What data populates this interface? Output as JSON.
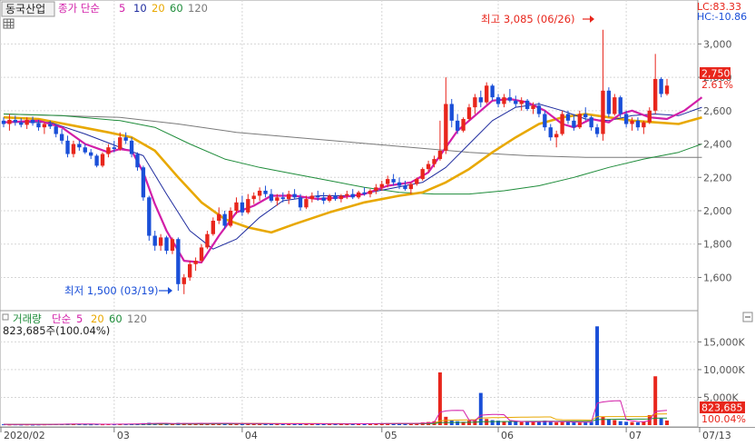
{
  "header": {
    "stock_name": "동국산업",
    "price_type": "종가 단순",
    "ma_periods": [
      "5",
      "10",
      "20",
      "60",
      "120"
    ],
    "lc": "LC:83.33",
    "hc": "HC:-10.86"
  },
  "volume_header": {
    "title": "거래량",
    "type": "단순",
    "ma_periods": [
      "5",
      "20",
      "60",
      "120"
    ],
    "value_text": "823,685주(100.04%)"
  },
  "annotations": {
    "high": "최고 3,085 (06/26)",
    "low": "최저 1,500 (03/19)"
  },
  "price_axis_labels": [
    "3,000",
    "2,800",
    "2,600",
    "2,400",
    "2,200",
    "2,000",
    "1,800",
    "1,600"
  ],
  "volume_axis_labels": [
    "15,000K",
    "10,000K",
    "5,000K"
  ],
  "x_axis_labels": [
    "2020/02",
    "03",
    "04",
    "05",
    "06",
    "07",
    "07/13"
  ],
  "badges": {
    "price": "2,750",
    "price_pct": "2.61%",
    "volume": "823,685",
    "volume_pct": "100.04%"
  },
  "colors": {
    "up": "#e8261c",
    "down": "#1a4fd8",
    "ma5": "#d21ea8",
    "ma10": "#1e2b9e",
    "ma20": "#e8a800",
    "ma60": "#1e8c3a",
    "ma120": "#7a7a7a"
  },
  "chart_data": {
    "type": "candlestick",
    "title": "동국산업",
    "y_axis": {
      "min": 1450,
      "max": 3100,
      "ticks": [
        1600,
        1800,
        2000,
        2200,
        2400,
        2600,
        2800,
        3000
      ]
    },
    "x_ticks": [
      {
        "label": "2020/02",
        "index": 0
      },
      {
        "label": "03",
        "index": 19
      },
      {
        "label": "04",
        "index": 41
      },
      {
        "label": "05",
        "index": 65
      },
      {
        "label": "06",
        "index": 85
      },
      {
        "label": "07",
        "index": 107
      },
      {
        "label": "07/13",
        "index": 120
      }
    ],
    "high": {
      "value": 3085,
      "date": "06/26"
    },
    "low": {
      "value": 1500,
      "date": "03/19"
    },
    "last_close": 2750,
    "last_change_pct": 2.61,
    "candles": [
      [
        2540,
        2560,
        2500,
        2520
      ],
      [
        2520,
        2580,
        2480,
        2545
      ],
      [
        2545,
        2570,
        2510,
        2530
      ],
      [
        2530,
        2555,
        2500,
        2515
      ],
      [
        2515,
        2560,
        2490,
        2545
      ],
      [
        2545,
        2565,
        2510,
        2525
      ],
      [
        2525,
        2545,
        2480,
        2500
      ],
      [
        2500,
        2530,
        2460,
        2520
      ],
      [
        2520,
        2540,
        2490,
        2505
      ],
      [
        2505,
        2520,
        2440,
        2460
      ],
      [
        2460,
        2490,
        2400,
        2420
      ],
      [
        2420,
        2450,
        2320,
        2340
      ],
      [
        2340,
        2420,
        2320,
        2400
      ],
      [
        2400,
        2420,
        2360,
        2380
      ],
      [
        2380,
        2400,
        2340,
        2350
      ],
      [
        2350,
        2370,
        2310,
        2330
      ],
      [
        2330,
        2340,
        2260,
        2270
      ],
      [
        2270,
        2350,
        2260,
        2340
      ],
      [
        2340,
        2400,
        2320,
        2380
      ],
      [
        2380,
        2420,
        2350,
        2370
      ],
      [
        2370,
        2470,
        2360,
        2440
      ],
      [
        2440,
        2470,
        2400,
        2420
      ],
      [
        2420,
        2440,
        2320,
        2340
      ],
      [
        2340,
        2350,
        2240,
        2260
      ],
      [
        2260,
        2270,
        2060,
        2080
      ],
      [
        2080,
        2090,
        1820,
        1850
      ],
      [
        1850,
        1880,
        1760,
        1790
      ],
      [
        1790,
        1860,
        1760,
        1840
      ],
      [
        1840,
        1850,
        1740,
        1760
      ],
      [
        1760,
        1840,
        1740,
        1830
      ],
      [
        1830,
        1840,
        1520,
        1560
      ],
      [
        1560,
        1620,
        1500,
        1600
      ],
      [
        1600,
        1700,
        1580,
        1680
      ],
      [
        1680,
        1720,
        1640,
        1700
      ],
      [
        1700,
        1800,
        1690,
        1780
      ],
      [
        1780,
        1880,
        1770,
        1860
      ],
      [
        1860,
        1960,
        1850,
        1940
      ],
      [
        1940,
        2020,
        1920,
        1980
      ],
      [
        1980,
        2000,
        1890,
        1910
      ],
      [
        1910,
        2020,
        1900,
        2000
      ],
      [
        2000,
        2080,
        1980,
        2050
      ],
      [
        2050,
        2090,
        1970,
        1990
      ],
      [
        1990,
        2100,
        1980,
        2070
      ],
      [
        2070,
        2110,
        2040,
        2090
      ],
      [
        2090,
        2140,
        2060,
        2120
      ],
      [
        2120,
        2150,
        2080,
        2100
      ],
      [
        2100,
        2130,
        2050,
        2060
      ],
      [
        2060,
        2100,
        2030,
        2080
      ],
      [
        2080,
        2110,
        2050,
        2070
      ],
      [
        2070,
        2120,
        2040,
        2100
      ],
      [
        2100,
        2130,
        2070,
        2080
      ],
      [
        2080,
        2100,
        2000,
        2020
      ],
      [
        2020,
        2090,
        2010,
        2070
      ],
      [
        2070,
        2110,
        2050,
        2090
      ],
      [
        2090,
        2120,
        2060,
        2080
      ],
      [
        2080,
        2110,
        2040,
        2060
      ],
      [
        2060,
        2100,
        2050,
        2090
      ],
      [
        2090,
        2110,
        2060,
        2070
      ],
      [
        2070,
        2100,
        2050,
        2090
      ],
      [
        2090,
        2120,
        2070,
        2100
      ],
      [
        2100,
        2130,
        2070,
        2080
      ],
      [
        2080,
        2120,
        2070,
        2110
      ],
      [
        2110,
        2140,
        2090,
        2100
      ],
      [
        2100,
        2130,
        2080,
        2120
      ],
      [
        2120,
        2160,
        2100,
        2140
      ],
      [
        2140,
        2180,
        2120,
        2160
      ],
      [
        2160,
        2210,
        2140,
        2190
      ],
      [
        2190,
        2220,
        2150,
        2170
      ],
      [
        2170,
        2200,
        2130,
        2150
      ],
      [
        2150,
        2180,
        2120,
        2130
      ],
      [
        2130,
        2170,
        2100,
        2160
      ],
      [
        2160,
        2200,
        2150,
        2190
      ],
      [
        2190,
        2260,
        2180,
        2250
      ],
      [
        2250,
        2300,
        2230,
        2280
      ],
      [
        2280,
        2330,
        2260,
        2310
      ],
      [
        2310,
        2540,
        2300,
        2360
      ],
      [
        2360,
        2800,
        2340,
        2640
      ],
      [
        2640,
        2670,
        2500,
        2540
      ],
      [
        2540,
        2580,
        2460,
        2480
      ],
      [
        2480,
        2560,
        2470,
        2550
      ],
      [
        2550,
        2640,
        2540,
        2620
      ],
      [
        2620,
        2700,
        2580,
        2680
      ],
      [
        2680,
        2720,
        2620,
        2650
      ],
      [
        2650,
        2770,
        2640,
        2750
      ],
      [
        2750,
        2760,
        2660,
        2680
      ],
      [
        2680,
        2700,
        2620,
        2640
      ],
      [
        2640,
        2700,
        2620,
        2680
      ],
      [
        2680,
        2730,
        2650,
        2660
      ],
      [
        2660,
        2690,
        2620,
        2640
      ],
      [
        2640,
        2680,
        2600,
        2660
      ],
      [
        2660,
        2670,
        2600,
        2610
      ],
      [
        2610,
        2650,
        2580,
        2630
      ],
      [
        2630,
        2650,
        2560,
        2580
      ],
      [
        2580,
        2600,
        2480,
        2500
      ],
      [
        2500,
        2520,
        2420,
        2440
      ],
      [
        2440,
        2480,
        2380,
        2460
      ],
      [
        2460,
        2600,
        2450,
        2580
      ],
      [
        2580,
        2600,
        2520,
        2540
      ],
      [
        2540,
        2580,
        2480,
        2500
      ],
      [
        2500,
        2600,
        2490,
        2580
      ],
      [
        2580,
        2620,
        2540,
        2560
      ],
      [
        2560,
        2570,
        2480,
        2500
      ],
      [
        2500,
        2520,
        2440,
        2460
      ],
      [
        2460,
        3085,
        2420,
        2720
      ],
      [
        2720,
        2740,
        2560,
        2580
      ],
      [
        2580,
        2700,
        2570,
        2680
      ],
      [
        2680,
        2690,
        2560,
        2580
      ],
      [
        2580,
        2600,
        2500,
        2520
      ],
      [
        2520,
        2560,
        2480,
        2540
      ],
      [
        2540,
        2560,
        2480,
        2500
      ],
      [
        2500,
        2540,
        2460,
        2530
      ],
      [
        2530,
        2620,
        2520,
        2600
      ],
      [
        2600,
        2940,
        2580,
        2790
      ],
      [
        2790,
        2800,
        2680,
        2700
      ],
      [
        2700,
        2790,
        2690,
        2750
      ]
    ],
    "ma_series": [
      {
        "name": "5",
        "points": [
          [
            0,
            2530
          ],
          [
            6,
            2540
          ],
          [
            10,
            2500
          ],
          [
            14,
            2400
          ],
          [
            18,
            2350
          ],
          [
            20,
            2370
          ],
          [
            22,
            2360
          ],
          [
            24,
            2230
          ],
          [
            26,
            2040
          ],
          [
            28,
            1880
          ],
          [
            31,
            1700
          ],
          [
            34,
            1690
          ],
          [
            37,
            1850
          ],
          [
            40,
            1990
          ],
          [
            43,
            2030
          ],
          [
            46,
            2090
          ],
          [
            50,
            2090
          ],
          [
            54,
            2070
          ],
          [
            58,
            2080
          ],
          [
            62,
            2100
          ],
          [
            66,
            2150
          ],
          [
            70,
            2170
          ],
          [
            73,
            2230
          ],
          [
            76,
            2380
          ],
          [
            78,
            2480
          ],
          [
            80,
            2540
          ],
          [
            82,
            2600
          ],
          [
            84,
            2660
          ],
          [
            87,
            2670
          ],
          [
            90,
            2650
          ],
          [
            93,
            2600
          ],
          [
            96,
            2520
          ],
          [
            98,
            2500
          ],
          [
            101,
            2550
          ],
          [
            104,
            2530
          ],
          [
            106,
            2580
          ],
          [
            108,
            2600
          ],
          [
            111,
            2560
          ],
          [
            114,
            2550
          ],
          [
            117,
            2600
          ],
          [
            120,
            2680
          ]
        ]
      },
      {
        "name": "10",
        "points": [
          [
            0,
            2530
          ],
          [
            8,
            2530
          ],
          [
            14,
            2460
          ],
          [
            20,
            2380
          ],
          [
            24,
            2330
          ],
          [
            28,
            2100
          ],
          [
            32,
            1880
          ],
          [
            36,
            1770
          ],
          [
            40,
            1830
          ],
          [
            44,
            1960
          ],
          [
            48,
            2060
          ],
          [
            54,
            2090
          ],
          [
            60,
            2090
          ],
          [
            66,
            2130
          ],
          [
            72,
            2170
          ],
          [
            76,
            2260
          ],
          [
            80,
            2400
          ],
          [
            84,
            2540
          ],
          [
            88,
            2620
          ],
          [
            92,
            2640
          ],
          [
            96,
            2600
          ],
          [
            100,
            2550
          ],
          [
            104,
            2540
          ],
          [
            108,
            2570
          ],
          [
            112,
            2580
          ],
          [
            116,
            2570
          ],
          [
            120,
            2620
          ]
        ]
      },
      {
        "name": "20",
        "points": [
          [
            0,
            2560
          ],
          [
            6,
            2550
          ],
          [
            12,
            2510
          ],
          [
            18,
            2470
          ],
          [
            22,
            2440
          ],
          [
            26,
            2360
          ],
          [
            30,
            2200
          ],
          [
            34,
            2050
          ],
          [
            38,
            1950
          ],
          [
            42,
            1900
          ],
          [
            46,
            1870
          ],
          [
            50,
            1920
          ],
          [
            56,
            1990
          ],
          [
            62,
            2050
          ],
          [
            68,
            2090
          ],
          [
            72,
            2110
          ],
          [
            76,
            2170
          ],
          [
            80,
            2250
          ],
          [
            84,
            2350
          ],
          [
            88,
            2440
          ],
          [
            92,
            2520
          ],
          [
            96,
            2560
          ],
          [
            100,
            2580
          ],
          [
            104,
            2560
          ],
          [
            108,
            2540
          ],
          [
            112,
            2530
          ],
          [
            116,
            2520
          ],
          [
            120,
            2560
          ]
        ]
      },
      {
        "name": "60",
        "points": [
          [
            0,
            2580
          ],
          [
            10,
            2570
          ],
          [
            20,
            2540
          ],
          [
            26,
            2500
          ],
          [
            32,
            2400
          ],
          [
            38,
            2310
          ],
          [
            44,
            2260
          ],
          [
            50,
            2220
          ],
          [
            56,
            2180
          ],
          [
            62,
            2140
          ],
          [
            68,
            2110
          ],
          [
            74,
            2100
          ],
          [
            80,
            2100
          ],
          [
            86,
            2120
          ],
          [
            92,
            2150
          ],
          [
            98,
            2200
          ],
          [
            104,
            2260
          ],
          [
            110,
            2310
          ],
          [
            116,
            2350
          ],
          [
            120,
            2400
          ]
        ]
      },
      {
        "name": "120",
        "points": [
          [
            0,
            2580
          ],
          [
            20,
            2560
          ],
          [
            30,
            2520
          ],
          [
            40,
            2470
          ],
          [
            50,
            2440
          ],
          [
            60,
            2410
          ],
          [
            70,
            2380
          ],
          [
            80,
            2350
          ],
          [
            90,
            2330
          ],
          [
            100,
            2320
          ],
          [
            110,
            2320
          ],
          [
            120,
            2320
          ]
        ]
      }
    ],
    "volume": {
      "y_axis": {
        "min": 0,
        "max": 18500,
        "ticks": [
          5000,
          10000,
          15000
        ]
      },
      "last": 823685,
      "last_pct": 100.04,
      "bars": [
        150,
        120,
        140,
        110,
        130,
        100,
        120,
        140,
        160,
        180,
        200,
        260,
        220,
        180,
        150,
        140,
        170,
        150,
        180,
        200,
        220,
        170,
        200,
        260,
        350,
        420,
        300,
        280,
        250,
        240,
        400,
        350,
        300,
        280,
        320,
        340,
        360,
        300,
        280,
        320,
        300,
        260,
        300,
        280,
        270,
        260,
        240,
        220,
        240,
        260,
        240,
        260,
        250,
        240,
        230,
        220,
        240,
        220,
        230,
        240,
        250,
        260,
        270,
        260,
        280,
        300,
        340,
        320,
        300,
        280,
        320,
        360,
        480,
        560,
        700,
        9500,
        1500,
        900,
        700,
        600,
        800,
        1000,
        5800,
        1100,
        900,
        800,
        700,
        650,
        600,
        550,
        600,
        580,
        700,
        800,
        600,
        500,
        550,
        600,
        500,
        450,
        500,
        600,
        17800,
        1500,
        1100,
        900,
        700,
        600,
        550,
        500,
        600,
        1800,
        8800,
        1200,
        824
      ]
    }
  }
}
